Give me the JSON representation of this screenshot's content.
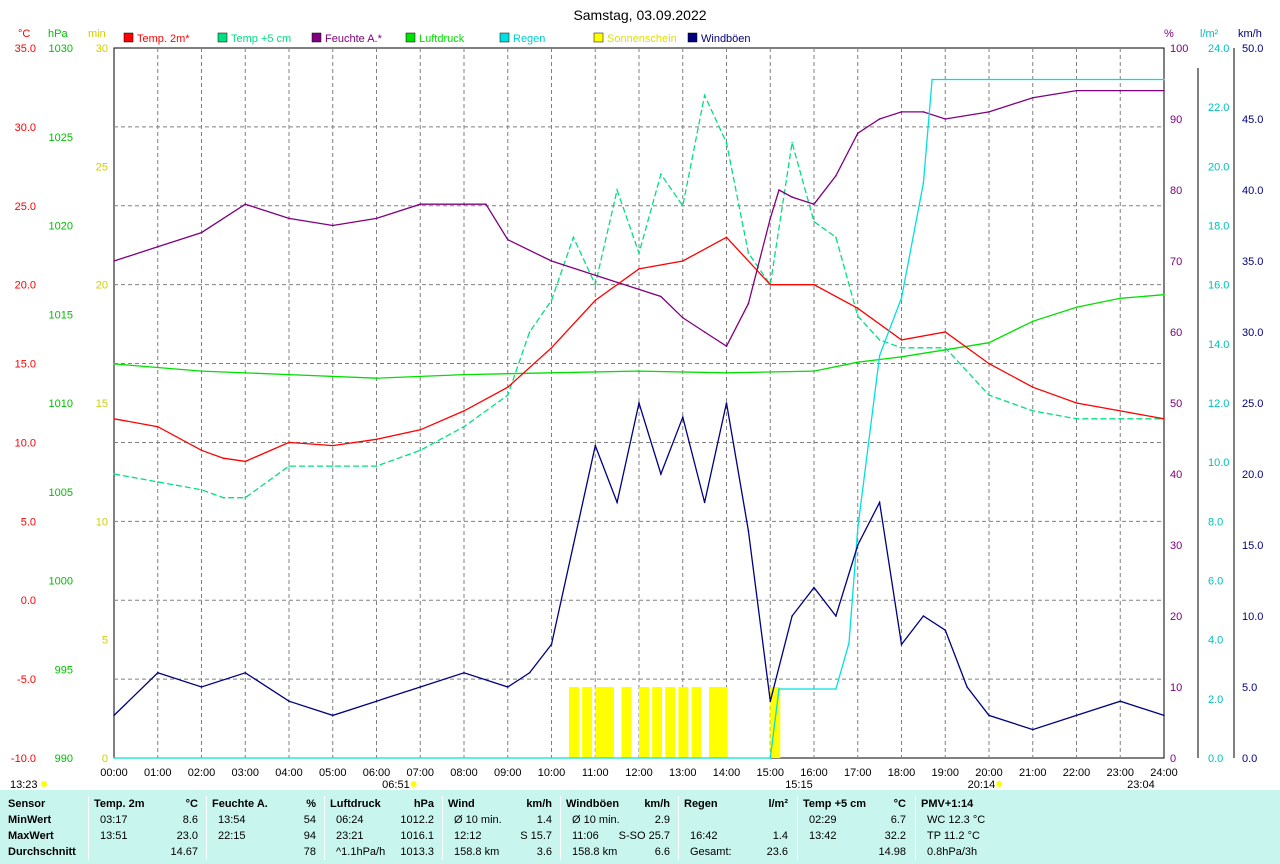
{
  "title": "Samstag, 03.09.2022",
  "axes": {
    "temp": {
      "unit": "°C",
      "ticks": [
        "35.0",
        "30.0",
        "25.0",
        "20.0",
        "15.0",
        "10.0",
        "5.0",
        "0.0",
        "-5.0",
        "-10.0"
      ],
      "color": "#ff0000"
    },
    "pressure": {
      "unit": "hPa",
      "ticks": [
        "1030",
        "1025",
        "1020",
        "1015",
        "1010",
        "1005",
        "1000",
        "995",
        "990"
      ],
      "color": "#00c000"
    },
    "sunshine": {
      "unit": "min",
      "ticks": [
        "30",
        "25",
        "20",
        "15",
        "10",
        "5",
        "0"
      ],
      "color": "#e0e000"
    },
    "humidity": {
      "unit": "%",
      "ticks": [
        "100",
        "90",
        "80",
        "70",
        "60",
        "50",
        "40",
        "30",
        "20",
        "10",
        "0"
      ],
      "color": "#800080"
    },
    "rain": {
      "unit": "l/m²",
      "ticks": [
        "24.0",
        "22.0",
        "20.0",
        "18.0",
        "16.0",
        "14.0",
        "12.0",
        "10.0",
        "8.0",
        "6.0",
        "4.0",
        "2.0",
        "0.0"
      ],
      "color": "#00d0d0"
    },
    "wind": {
      "unit": "km/h",
      "ticks": [
        "50.0",
        "45.0",
        "40.0",
        "35.0",
        "30.0",
        "25.0",
        "20.0",
        "15.0",
        "10.0",
        "5.0",
        "0.0"
      ],
      "color": "#000080"
    },
    "time_ticks": [
      "00:00",
      "01:00",
      "02:00",
      "03:00",
      "04:00",
      "05:00",
      "06:00",
      "07:00",
      "08:00",
      "09:00",
      "10:00",
      "11:00",
      "12:00",
      "13:00",
      "14:00",
      "15:00",
      "16:00",
      "17:00",
      "18:00",
      "19:00",
      "20:00",
      "21:00",
      "22:00",
      "23:00",
      "24:00"
    ]
  },
  "markers": {
    "moonrise": "13:23",
    "sunrise": "06:51",
    "rain_start": "15:15",
    "sunset": "20:14",
    "moonset": "23:04"
  },
  "legend": [
    {
      "label": "Temp. 2m*",
      "color": "#ff0000"
    },
    {
      "label": "Temp +5 cm",
      "color": "#00e080"
    },
    {
      "label": "Feuchte A.*",
      "color": "#800080"
    },
    {
      "label": "Luftdruck",
      "color": "#00e000"
    },
    {
      "label": "Regen",
      "color": "#00e0e0"
    },
    {
      "label": "Sonnenschein",
      "color": "#ffff00"
    },
    {
      "label": "Windböen",
      "color": "#000080"
    }
  ],
  "chart_data": {
    "type": "line",
    "title": "Samstag, 03.09.2022",
    "x_range": [
      "00:00",
      "24:00"
    ],
    "series": [
      {
        "name": "Temp. 2m*",
        "unit": "°C",
        "x": [
          0,
          1,
          2,
          2.5,
          3,
          4,
          5,
          6,
          7,
          8,
          9,
          10,
          11,
          12,
          13,
          14,
          15,
          16,
          17,
          18,
          19,
          20,
          21,
          22,
          23,
          24
        ],
        "values": [
          11.5,
          11,
          9.5,
          9,
          8.8,
          10,
          9.8,
          10.2,
          10.8,
          12,
          13.5,
          16,
          19,
          21,
          21.5,
          23,
          20,
          20,
          18.5,
          16.5,
          17,
          15,
          13.5,
          12.5,
          12,
          11.5
        ]
      },
      {
        "name": "Temp +5 cm",
        "unit": "°C",
        "x": [
          0,
          1,
          2,
          2.5,
          3,
          4,
          5,
          6,
          7,
          8,
          9,
          9.5,
          10,
          10.5,
          11,
          11.5,
          12,
          12.5,
          13,
          13.5,
          14,
          14.5,
          15,
          15.5,
          16,
          16.5,
          17,
          17.5,
          18,
          19,
          20,
          21,
          22,
          23,
          24
        ],
        "values": [
          8,
          7.5,
          7,
          6.5,
          6.5,
          8.5,
          8.5,
          8.5,
          9.5,
          11,
          13,
          17,
          19,
          23,
          20,
          26,
          22,
          27,
          25,
          32,
          29,
          22,
          20,
          29,
          24,
          23,
          18,
          16.5,
          16,
          16,
          13,
          12,
          11.5,
          11.5,
          11.5
        ]
      },
      {
        "name": "Feuchte A.*",
        "unit": "%",
        "x": [
          0,
          1,
          2,
          3,
          4,
          5,
          6,
          7,
          8,
          8.5,
          9,
          10,
          11,
          12,
          12.5,
          13,
          13.5,
          14,
          14.5,
          15,
          15.2,
          15.5,
          16,
          16.5,
          17,
          17.5,
          18,
          18.5,
          19,
          20,
          21,
          22,
          23,
          24
        ],
        "values": [
          70,
          72,
          74,
          78,
          76,
          75,
          76,
          78,
          78,
          78,
          73,
          70,
          68,
          66,
          65,
          62,
          60,
          58,
          64,
          76,
          80,
          79,
          78,
          82,
          88,
          90,
          91,
          91,
          90,
          91,
          93,
          94,
          94,
          94
        ]
      },
      {
        "name": "Luftdruck",
        "unit": "hPa",
        "x": [
          0,
          2,
          4,
          6,
          8,
          10,
          12,
          14,
          16,
          17,
          18,
          19,
          20,
          21,
          22,
          23,
          24
        ],
        "values": [
          1012.2,
          1011.8,
          1011.6,
          1011.4,
          1011.6,
          1011.7,
          1011.8,
          1011.7,
          1011.8,
          1012.3,
          1012.6,
          1013.0,
          1013.4,
          1014.6,
          1015.4,
          1015.9,
          1016.1
        ]
      },
      {
        "name": "Regen",
        "unit": "l/m²",
        "x": [
          0,
          15,
          15.2,
          16.5,
          16.8,
          17,
          17.5,
          18,
          18.5,
          18.7,
          19,
          24
        ],
        "values": [
          0,
          0,
          2.4,
          2.4,
          4,
          8,
          14,
          16,
          20,
          23.6,
          23.6,
          23.6
        ]
      },
      {
        "name": "Windböen",
        "unit": "km/h",
        "x": [
          0,
          1,
          2,
          3,
          4,
          5,
          6,
          7,
          8,
          9,
          9.5,
          10,
          10.5,
          11,
          11.5,
          12,
          12.5,
          13,
          13.5,
          14,
          14.5,
          15,
          15.5,
          16,
          16.5,
          17,
          17.5,
          18,
          18.5,
          19,
          19.5,
          20,
          21,
          22,
          23,
          24
        ],
        "values": [
          3,
          6,
          5,
          6,
          4,
          3,
          4,
          5,
          6,
          5,
          6,
          8,
          15,
          22,
          18,
          25,
          20,
          24,
          18,
          25,
          16,
          4,
          10,
          12,
          10,
          15,
          18,
          8,
          10,
          9,
          5,
          3,
          2,
          3,
          4,
          3
        ]
      },
      {
        "name": "Sonnenschein",
        "unit": "min",
        "x": [
          10.4,
          10.7,
          11,
          11.2,
          11.6,
          12,
          12.3,
          12.6,
          12.9,
          13.2,
          13.6,
          13.8,
          15.0
        ],
        "values": [
          3,
          3,
          3,
          3,
          3,
          3,
          3,
          3,
          3,
          3,
          3,
          3,
          3
        ]
      }
    ]
  },
  "stats": {
    "headers": [
      {
        "label": "Sensor",
        "unit": ""
      },
      {
        "label": "Temp. 2m",
        "unit": "°C"
      },
      {
        "label": "Feuchte A.",
        "unit": "%"
      },
      {
        "label": "Luftdruck",
        "unit": "hPa"
      },
      {
        "label": "Wind",
        "unit": "km/h"
      },
      {
        "label": "Windböen",
        "unit": "km/h"
      },
      {
        "label": "Regen",
        "unit": "l/m²"
      },
      {
        "label": "Temp +5 cm",
        "unit": "°C"
      },
      {
        "label": "PMV+1:14",
        "unit": ""
      }
    ],
    "rows": [
      {
        "label": "MinWert",
        "cells": [
          [
            "03:17",
            "8.6"
          ],
          [
            "13:54",
            "54"
          ],
          [
            "06:24",
            "1012.2"
          ],
          [
            "Ø 10 min.",
            "1.4"
          ],
          [
            "Ø 10 min.",
            "2.9"
          ],
          [
            "",
            ""
          ],
          [
            "02:29",
            "6.7"
          ],
          [
            "WC 12.3 °C",
            ""
          ]
        ]
      },
      {
        "label": "MaxWert",
        "cells": [
          [
            "13:51",
            "23.0"
          ],
          [
            "22:15",
            "94"
          ],
          [
            "23:21",
            "1016.1"
          ],
          [
            "12:12",
            "S 15.7"
          ],
          [
            "11:06",
            "S-SO 25.7"
          ],
          [
            "16:42",
            "1.4"
          ],
          [
            "13:42",
            "32.2"
          ],
          [
            "TP 11.2 °C",
            ""
          ]
        ]
      },
      {
        "label": "Durchschnitt",
        "cells": [
          [
            "",
            "14.67"
          ],
          [
            "",
            "78"
          ],
          [
            "^1.1hPa/h",
            "1013.3"
          ],
          [
            "158.8 km",
            "3.6"
          ],
          [
            "158.8 km",
            "6.6"
          ],
          [
            "Gesamt:",
            "23.6"
          ],
          [
            "",
            "14.98"
          ],
          [
            "0.8hPa/3h",
            ""
          ]
        ]
      }
    ]
  }
}
